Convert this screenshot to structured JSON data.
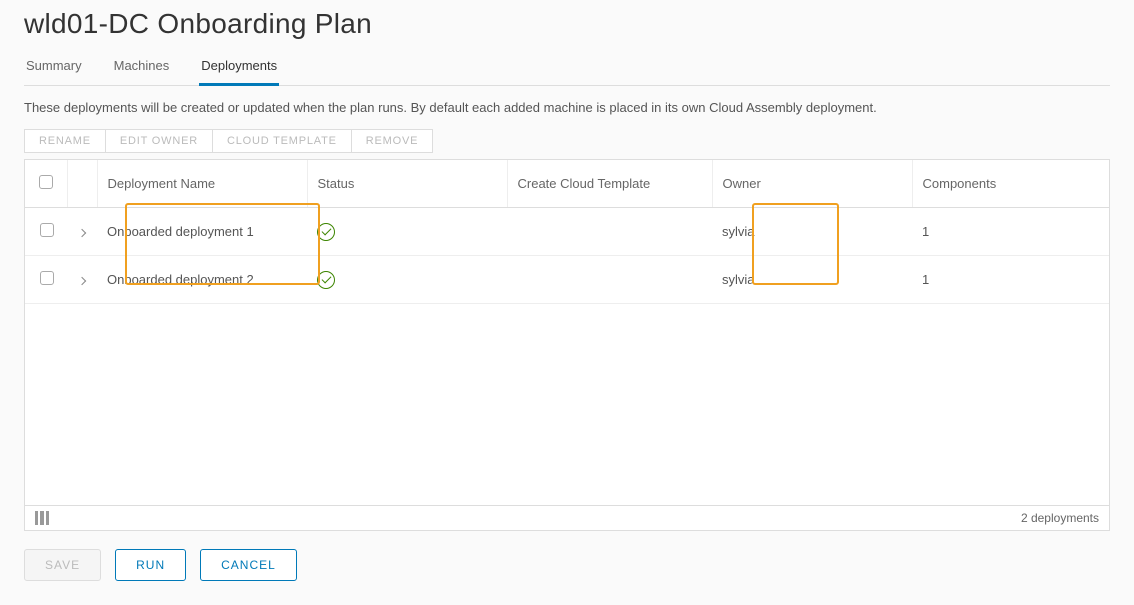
{
  "page_title": "wld01-DC Onboarding Plan",
  "tabs": [
    {
      "label": "Summary",
      "active": false
    },
    {
      "label": "Machines",
      "active": false
    },
    {
      "label": "Deployments",
      "active": true
    }
  ],
  "description": "These deployments will be created or updated when the plan runs. By default each added machine is placed in its own Cloud Assembly deployment.",
  "action_buttons": {
    "rename": "RENAME",
    "edit_owner": "EDIT OWNER",
    "cloud_template": "CLOUD TEMPLATE",
    "remove": "REMOVE"
  },
  "columns": {
    "name": "Deployment Name",
    "status": "Status",
    "template": "Create Cloud Template",
    "owner": "Owner",
    "components": "Components"
  },
  "rows": [
    {
      "name": "Onboarded deployment 1",
      "status": "ok",
      "template": "",
      "owner": "sylvia",
      "components": "1"
    },
    {
      "name": "Onboarded deployment 2",
      "status": "ok",
      "template": "",
      "owner": "sylvia",
      "components": "1"
    }
  ],
  "footer": {
    "count_text": "2 deployments"
  },
  "buttons": {
    "save": "SAVE",
    "run": "RUN",
    "cancel": "CANCEL"
  }
}
